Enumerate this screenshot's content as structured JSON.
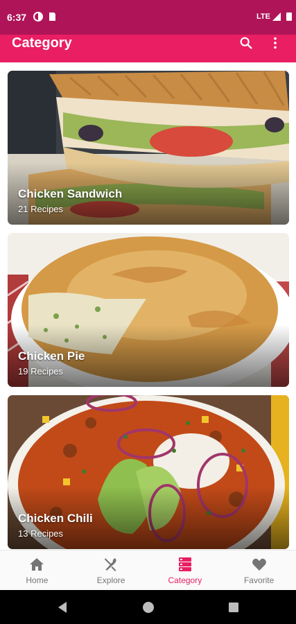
{
  "status_bar": {
    "time": "6:37",
    "network": "LTE"
  },
  "app_bar": {
    "title": "Category",
    "search_icon": "search-icon",
    "menu_icon": "more-vert-icon"
  },
  "categories": [
    {
      "title": "Chicken Sandwich",
      "count": "21 Recipes"
    },
    {
      "title": "Chicken Pie",
      "count": "19 Recipes"
    },
    {
      "title": "Chicken Chili",
      "count": "13 Recipes"
    }
  ],
  "bottom_nav": {
    "items": [
      {
        "label": "Home",
        "icon": "home-icon"
      },
      {
        "label": "Explore",
        "icon": "fork-knife-icon"
      },
      {
        "label": "Category",
        "icon": "category-icon",
        "active": true
      },
      {
        "label": "Favorite",
        "icon": "heart-icon"
      }
    ]
  },
  "colors": {
    "primary": "#e91e63",
    "status_bar": "#b01458",
    "inactive": "#757575"
  }
}
